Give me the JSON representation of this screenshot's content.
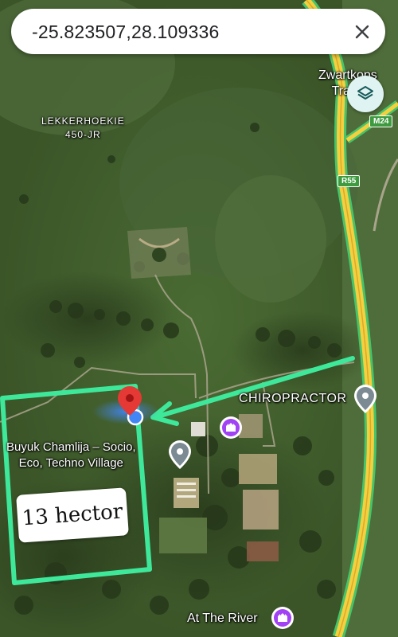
{
  "search": {
    "query": "-25.823507,28.109336",
    "clear_icon": "close-icon"
  },
  "layers": {
    "icon": "layers-icon"
  },
  "places": {
    "lekkerhoekie_line1": "LEKKERHOEKIE",
    "lekkerhoekie_line2": "450-JR",
    "zwartkops_line1": "Zwartkops",
    "zwartkops_line2": "Training",
    "chiropractor": "CHIROPRACTOR",
    "village_line1": "Buyuk Chamlija – Socio,",
    "village_line2": "Eco, Techno Village",
    "at_the_river": "At The River"
  },
  "roads": {
    "m24": "M24",
    "r55": "R55"
  },
  "annotation": {
    "area_label": "13 hector",
    "color": "#3ee89a"
  },
  "colors": {
    "highway": "#f4d03f",
    "highway_edge": "#47c46a",
    "pin_red": "#e53935",
    "location_blue": "#4285f4",
    "poi_purple": "#a142f4"
  }
}
